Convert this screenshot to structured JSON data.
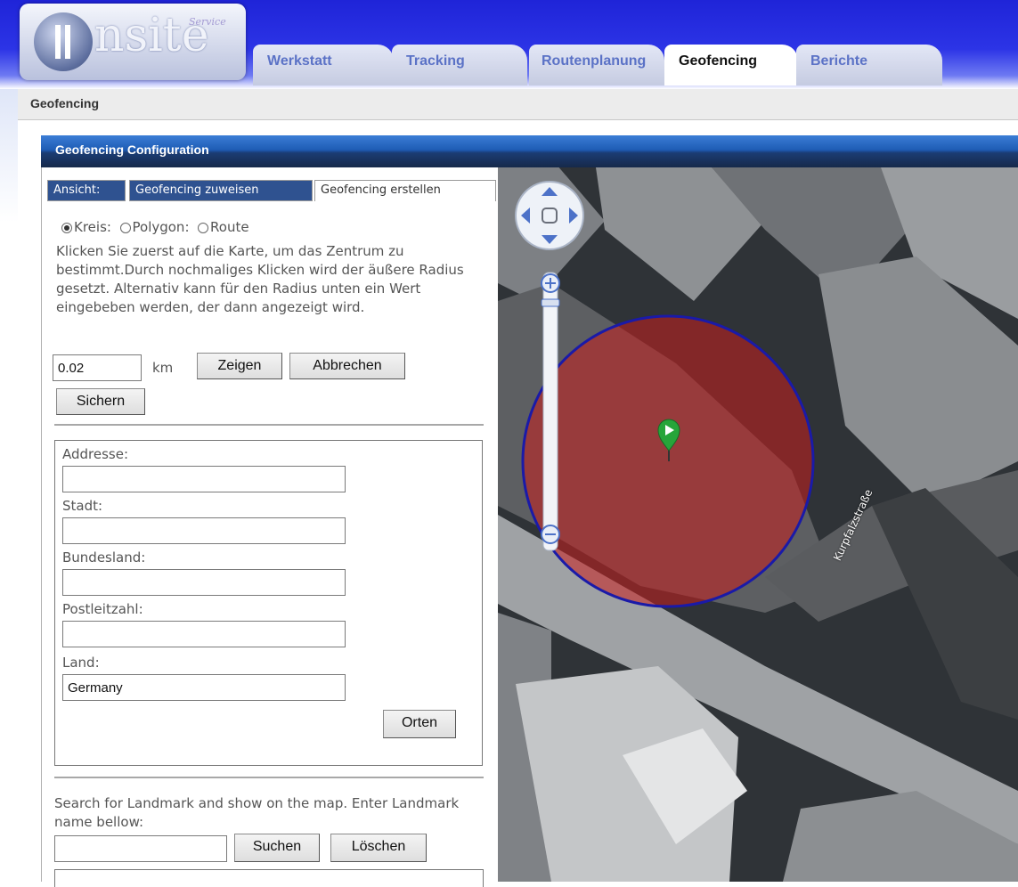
{
  "header": {
    "logo_text": "nsite",
    "logo_script": "Service",
    "tabs": [
      {
        "label": "Werkstatt",
        "active": false
      },
      {
        "label": "Tracking",
        "active": false
      },
      {
        "label": "Routenplanung",
        "active": false
      },
      {
        "label": "Geofencing",
        "active": true
      },
      {
        "label": "Berichte",
        "active": false
      }
    ]
  },
  "breadcrumb": "Geofencing",
  "panel": {
    "title": "Geofencing Configuration",
    "subtabs": {
      "ansicht": "Ansicht:",
      "zuweisen": "Geofencing zuweisen",
      "erstellen": "Geofencing erstellen"
    }
  },
  "shape": {
    "kreis": "Kreis:",
    "polygon": "Polygon:",
    "route": "Route",
    "selected": "Kreis"
  },
  "instructions": "Klicken Sie zuerst auf die Karte, um das Zentrum zu bestimmt.Durch nochmaliges Klicken wird der äußere Radius gesetzt. Alternativ kann für den Radius unten ein Wert eingebeben werden, der dann angezeigt wird.",
  "radius": {
    "value": "0.02",
    "unit": "km",
    "show_label": "Zeigen",
    "cancel_label": "Abbrechen",
    "save_label": "Sichern"
  },
  "address": {
    "addresse_label": "Addresse:",
    "addresse_value": "",
    "stadt_label": "Stadt:",
    "stadt_value": "",
    "bundesland_label": "Bundesland:",
    "bundesland_value": "",
    "plz_label": "Postleitzahl:",
    "plz_value": "",
    "land_label": "Land:",
    "land_value": "Germany",
    "locate_label": "Orten"
  },
  "landmark": {
    "instructions": "Search for Landmark and show on the map. Enter Landmark name bellow:",
    "value": "",
    "search_label": "Suchen",
    "clear_label": "Löschen"
  },
  "map": {
    "street_label": "Kurpfalzstraße",
    "zoom_in": "+",
    "zoom_out": "−",
    "circle_color": "#1a1aa8",
    "fill_color": "#c81e1e",
    "marker_color": "#27a53a"
  }
}
